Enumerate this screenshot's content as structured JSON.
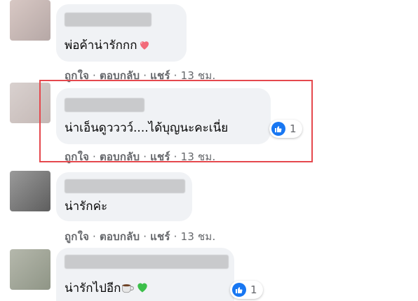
{
  "comments": [
    {
      "text": "พ่อค้าน่ารักกก",
      "emoji": "heart-emoji",
      "actions": {
        "like": "ถูกใจ",
        "reply": "ตอบกลับ",
        "share": "แชร์",
        "time": "13 ชม."
      }
    },
    {
      "text": "น่าเอ็นดูวววว์....ได้บุญนะคะเนี่ย",
      "reaction": {
        "icon": "thumbs-up-icon",
        "count": "1"
      },
      "actions": {
        "like": "ถูกใจ",
        "reply": "ตอบกลับ",
        "share": "แชร์",
        "time": "13 ชม."
      },
      "highlighted": true
    },
    {
      "text": "น่ารักค่ะ",
      "actions": {
        "like": "ถูกใจ",
        "reply": "ตอบกลับ",
        "share": "แชร์",
        "time": "13 ชม."
      }
    },
    {
      "text": "น่ารักไปอีก",
      "emoji": [
        "coffee-emoji",
        "green-heart-emoji"
      ],
      "reaction": {
        "icon": "thumbs-up-icon",
        "count": "1"
      }
    }
  ],
  "separator": "·",
  "colors": {
    "bubble": "#f0f2f5",
    "meta_text": "#65676b",
    "like_blue": "#1877f2",
    "highlight_border": "#e5484d"
  }
}
